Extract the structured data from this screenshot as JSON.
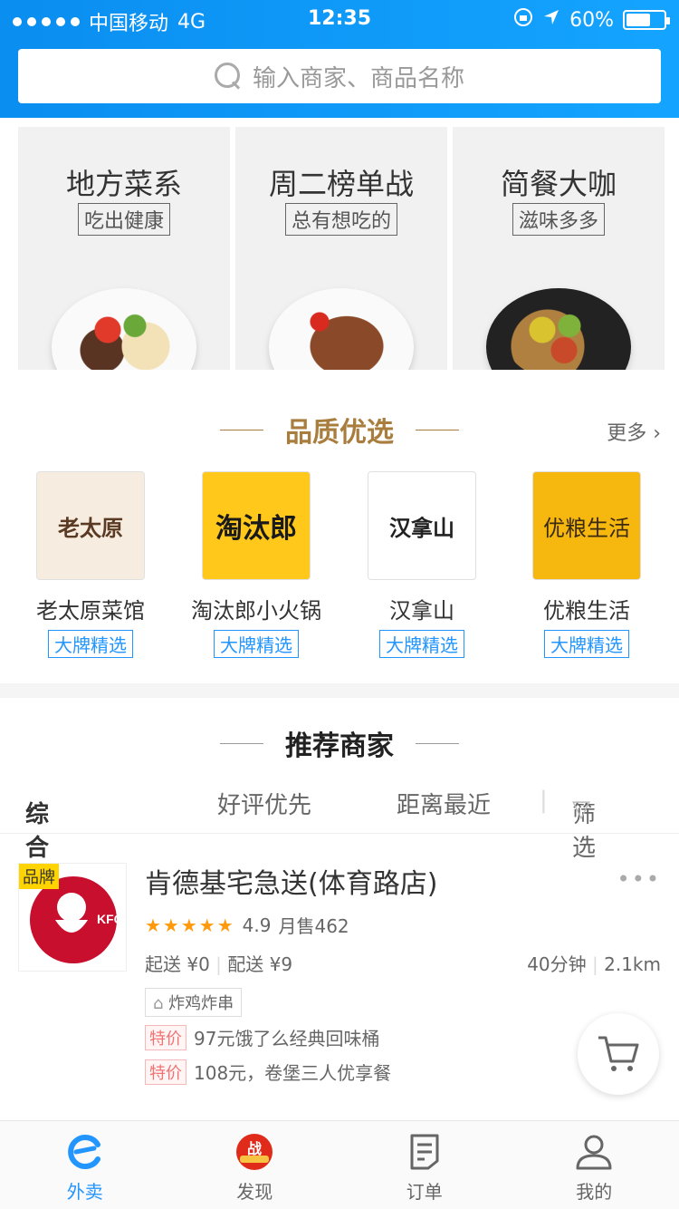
{
  "status_bar": {
    "carrier": "中国移动",
    "network": "4G",
    "time": "12:35",
    "battery": "60%"
  },
  "search": {
    "placeholder": "输入商家、商品名称"
  },
  "promos": [
    {
      "title": "地方菜系",
      "tag": "吃出健康"
    },
    {
      "title": "周二榜单战",
      "tag": "总有想吃的"
    },
    {
      "title": "简餐大咖",
      "tag": "滋味多多"
    }
  ],
  "quality": {
    "title": "品质优选",
    "more": "更多",
    "brands": [
      {
        "name": "老太原菜馆",
        "badge": "大牌精选",
        "logo_text": "老太原"
      },
      {
        "name": "淘汰郎小火锅",
        "badge": "大牌精选",
        "logo_text": "淘汰郎"
      },
      {
        "name": "汉拿山",
        "badge": "大牌精选",
        "logo_text": "汉拿山"
      },
      {
        "name": "优粮生活",
        "badge": "大牌精选",
        "logo_text": "优粮生活"
      }
    ]
  },
  "recommended": {
    "title": "推荐商家",
    "sort": {
      "default": "综合排序",
      "rating": "好评优先",
      "distance": "距离最近",
      "filter": "筛选"
    },
    "shop": {
      "brand_tag": "品牌",
      "name": "肯德基宅急送(体育路店)",
      "stars": "★★★★★",
      "score": "4.9",
      "monthly_sales": "月售462",
      "min_order": "起送 ¥0",
      "delivery_fee": "配送 ¥9",
      "time": "40分钟",
      "distance": "2.1km",
      "category": "炸鸡炸串",
      "promos": [
        {
          "tag": "特价",
          "text": "97元饿了么经典回味桶"
        },
        {
          "tag": "特价",
          "text": "108元，卷堡三人优享餐"
        }
      ]
    }
  },
  "tabs": [
    {
      "label": "外卖",
      "icon": "ele-logo-icon"
    },
    {
      "label": "发现",
      "icon": "discover-icon"
    },
    {
      "label": "订单",
      "icon": "order-icon"
    },
    {
      "label": "我的",
      "icon": "profile-icon"
    }
  ],
  "colors": {
    "primary": "#2395ff",
    "header": "#0a8ef0",
    "gold": "#a87d3e",
    "star": "#ff9a0d",
    "special": "#f07373"
  }
}
